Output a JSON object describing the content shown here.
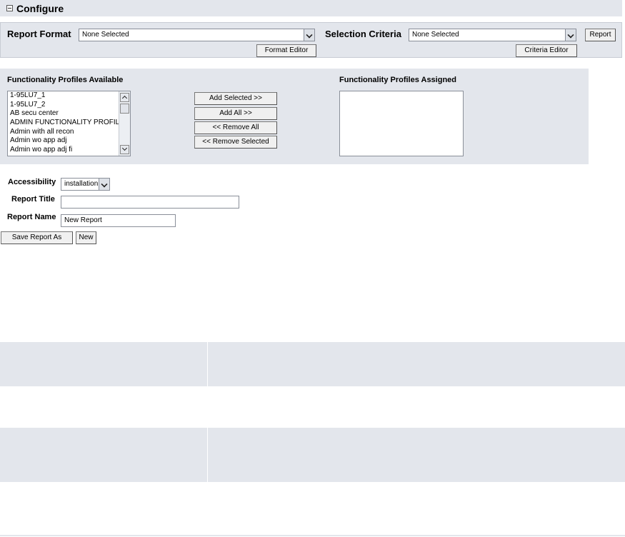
{
  "section": {
    "title": "Configure"
  },
  "report_format": {
    "label": "Report Format",
    "selected": "None Selected",
    "editor_button": "Format Editor"
  },
  "selection_criteria": {
    "label": "Selection Criteria",
    "selected": "None Selected",
    "editor_button": "Criteria Editor",
    "report_button": "Report"
  },
  "profiles": {
    "available_label": "Functionality Profiles Available",
    "assigned_label": "Functionality Profiles Assigned",
    "available_items": [
      "1-95LU7_1",
      "1-95LU7_2",
      "AB secu center",
      "ADMIN FUNCTIONALITY PROFILE",
      "Admin with all recon",
      "Admin wo app adj",
      "Admin wo app adj fi"
    ],
    "buttons": {
      "add_selected": "Add Selected >>",
      "add_all": "Add All >>",
      "remove_all": "<< Remove All",
      "remove_selected": "<< Remove Selected"
    }
  },
  "form": {
    "accessibility_label": "Accessibility",
    "accessibility_value": "installation",
    "report_title_label": "Report Title",
    "report_title_value": "",
    "report_name_label": "Report Name",
    "report_name_value": "New Report",
    "save_as_button": "Save Report As",
    "new_button": "New"
  },
  "colors": {
    "panel_background": "#e3e6ec",
    "page_background": "#ffffff"
  }
}
